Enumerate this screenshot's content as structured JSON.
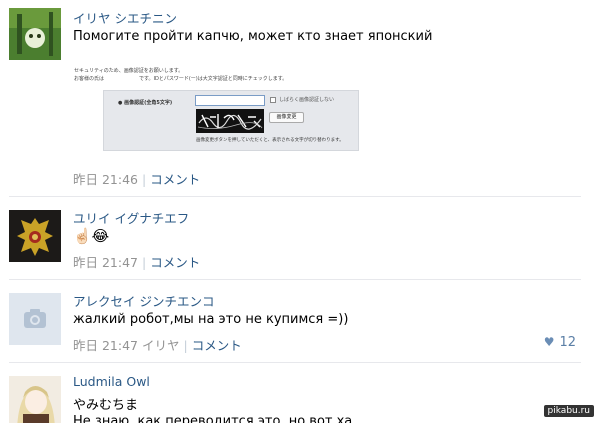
{
  "comments": [
    {
      "author": "イリヤ シエチニン",
      "text": "Помогите пройти капчю, может кто знает японский",
      "time": "昨日 21:46",
      "action": "コメント"
    },
    {
      "author": "ユリイ イグナチエフ",
      "text": "☝🏻😂",
      "time": "昨日 21:47",
      "action": "コメント"
    },
    {
      "author": "アレクセイ ジンチエンコ",
      "text": "жалкий робот,мы на это не купимся =))",
      "time": "昨日 21:47",
      "reply_to": "イリヤ",
      "action": "コメント",
      "likes": "12"
    },
    {
      "author": "Ludmila Owl",
      "text": "やみむちま",
      "text2": "Не знаю, как переводится это, но вот ха"
    }
  ],
  "captcha_form": {
    "note_line1": "セキュリティのため、画像認証をお願いします。",
    "note_line2": "お客様の氏は　　　　　　　です。IDとパスワード(ー)は大文字認証と同時にチェックします。",
    "field_label": "● 画像認証(全角5文字)",
    "checkbox_label": "しばらく画像認証しない",
    "refresh_button": "画像変更",
    "hint": "画像変更ボタンを押していただくと、表示される文字が切り替わります。"
  },
  "watermark": "pikabu.ru",
  "colors": {
    "link": "#2a5885",
    "meta": "#939393",
    "divider": "#e7e8ec"
  },
  "icons": [
    "camera-icon",
    "heart-icon"
  ]
}
